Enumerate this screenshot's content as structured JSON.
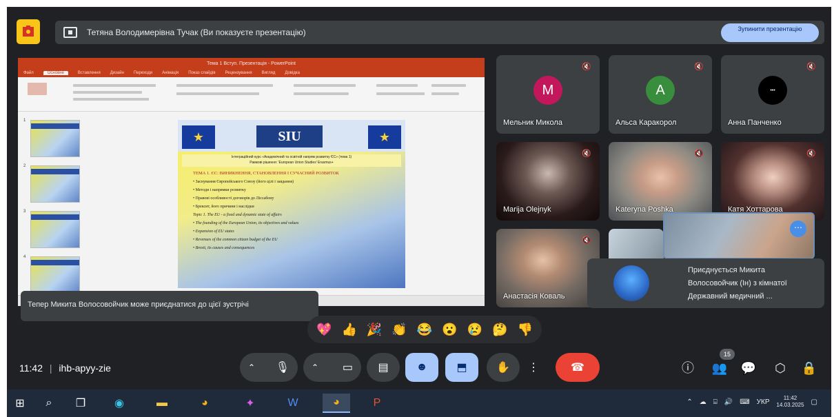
{
  "header": {
    "presenting_text": "Тетяна Володимерівна Тучак (Ви показуєте презентацію)",
    "stop_button": "Зупинити презентацію"
  },
  "screen": {
    "window_title": "Тема 1 Вступ. Презентація - PowerPoint",
    "tabs": [
      "Файл",
      "Основне",
      "Вставлення",
      "Дизайн",
      "Переходи",
      "Анімація",
      "Показ слайдів",
      "Рецензування",
      "Вигляд",
      "Довідка"
    ],
    "slide_numbers": [
      "1",
      "2",
      "3",
      "4"
    ],
    "slide": {
      "logo_text": "SIU",
      "heading": "Інтеграційний курс «Академічний та освітній напрям розвитку ЄС» (тема 1)",
      "subheading": "Рамкові рішення: 'European Union Studies' Erasmus+",
      "title": "ТЕМА 1. ЄС: ВИНИКНЕННЯ, СТАНОВЛЕННЯ І СУЧАСНИЙ РОЗВИТОК",
      "bullets": [
        "Заснування Європейського Союзу (його цілі і завдання)",
        "Методи і напрямки розвитку",
        "Правові особливості договорів до Ліссабону",
        "Брексит, його причини і наслідки",
        "Topic 1. The EU - a fixed and dynamic state of affairs",
        "The founding of the European Union, its objectives and values",
        "Expansion of EU states",
        "Revenues of the common citizen budget of the EU",
        "Brexit, its causes and consequences"
      ]
    }
  },
  "participants": [
    {
      "name": "Мельник Микола",
      "initial": "M",
      "color": "#c2185b"
    },
    {
      "name": "Альса Каракорол",
      "initial": "A",
      "color": "#388e3c"
    },
    {
      "name": "Анна Панченко",
      "initial": "",
      "color": "#000000"
    },
    {
      "name": "Marija Olejnyk",
      "initial": "",
      "color": ""
    },
    {
      "name": "Kateryna Poshka",
      "initial": "",
      "color": ""
    },
    {
      "name": "Катя Хоттарова",
      "initial": "",
      "color": ""
    },
    {
      "name": "Анастасія Коваль",
      "initial": "",
      "color": ""
    }
  ],
  "join_notification": {
    "line1": "Приєднується Микита",
    "line2": "Волосовойчик (Ін) з кімнатої",
    "line3": "Державний медичний ..."
  },
  "toast": "Тепер Микита Волосовойчик може приєднатися до цієї зустрічі",
  "reactions": [
    "💖",
    "👍",
    "🎉",
    "👏",
    "😂",
    "😮",
    "😢",
    "🤔",
    "👎"
  ],
  "meeting": {
    "time": "11:42",
    "separator": "|",
    "code": "ihb-apyy-zie"
  },
  "people_count": "15",
  "taskbar": {
    "lang": "УКР",
    "time": "11:42",
    "date": "14.03.2025"
  }
}
